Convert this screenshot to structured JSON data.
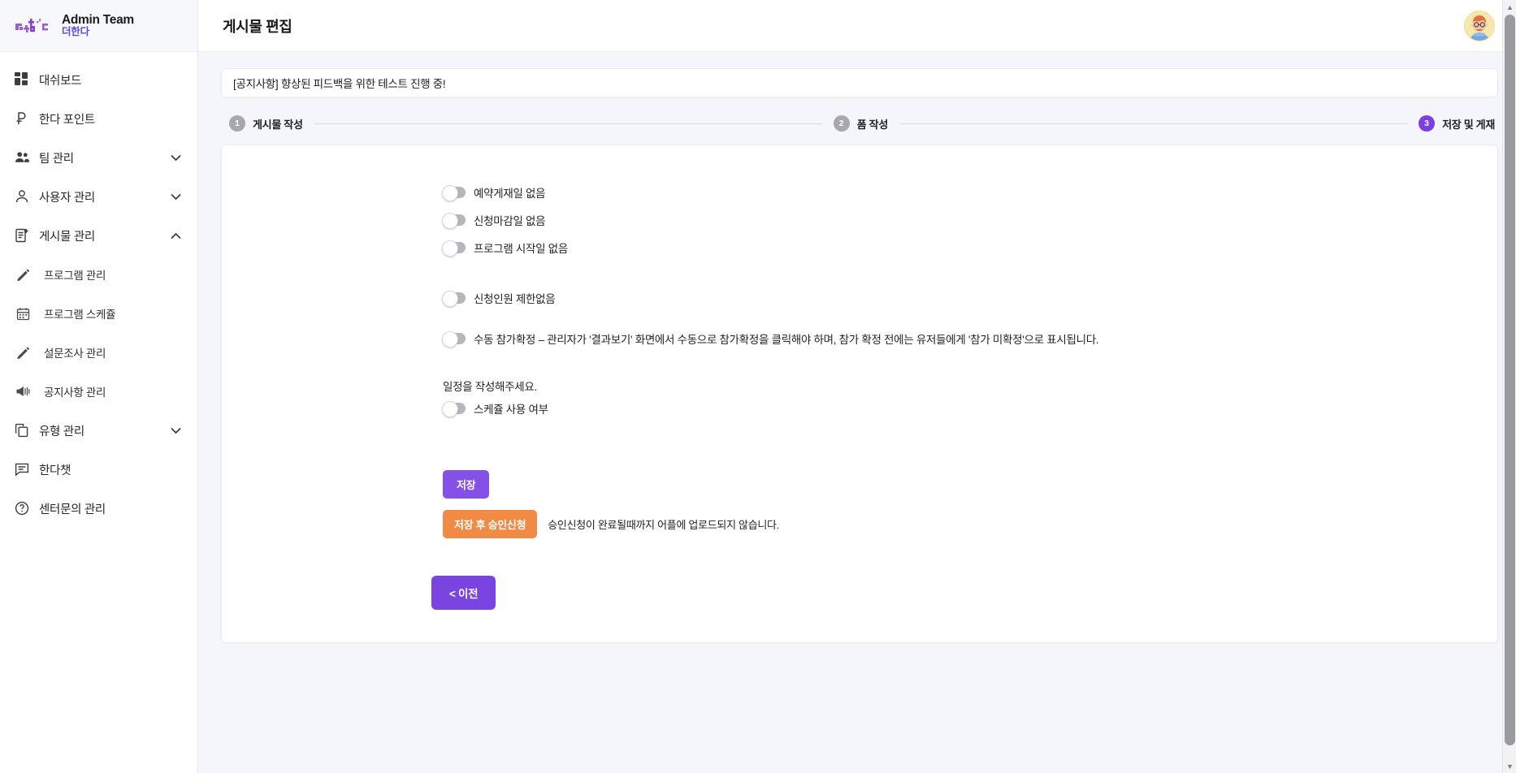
{
  "brand": {
    "title": "Admin Team",
    "subtitle": "더한다",
    "logo_icon": "dahanda-logo-icon"
  },
  "sidebar": {
    "items": [
      {
        "label": "대쉬보드",
        "icon": "dashboard-icon",
        "expandable": false,
        "sub": false
      },
      {
        "label": "한다 포인트",
        "icon": "point-icon",
        "expandable": false,
        "sub": false
      },
      {
        "label": "팀 관리",
        "icon": "group-icon",
        "expandable": true,
        "expanded": false,
        "sub": false
      },
      {
        "label": "사용자 관리",
        "icon": "person-icon",
        "expandable": true,
        "expanded": false,
        "sub": false
      },
      {
        "label": "게시물 관리",
        "icon": "post-add-icon",
        "expandable": true,
        "expanded": true,
        "sub": false
      },
      {
        "label": "프로그램 관리",
        "icon": "pencil-icon",
        "expandable": false,
        "sub": true
      },
      {
        "label": "프로그램 스케쥴",
        "icon": "calendar-icon",
        "expandable": false,
        "sub": true
      },
      {
        "label": "설문조사 관리",
        "icon": "pencil-icon",
        "expandable": false,
        "sub": true
      },
      {
        "label": "공지사항 관리",
        "icon": "megaphone-icon",
        "expandable": false,
        "sub": true
      },
      {
        "label": "유형 관리",
        "icon": "copy-icon",
        "expandable": true,
        "expanded": false,
        "sub": false
      },
      {
        "label": "한다챗",
        "icon": "chat-icon",
        "expandable": false,
        "sub": false
      },
      {
        "label": "센터문의 관리",
        "icon": "help-circle-icon",
        "expandable": false,
        "sub": false
      }
    ]
  },
  "header": {
    "title": "게시물 편집",
    "avatar_icon": "user-avatar"
  },
  "notice": {
    "text": "[공지사항] 향상된 피드백을 위한 테스트 진행 중!"
  },
  "stepper": {
    "steps": [
      {
        "number": "1",
        "label": "게시물 작성",
        "active": false
      },
      {
        "number": "2",
        "label": "폼 작성",
        "active": false
      },
      {
        "number": "3",
        "label": "저장 및 게재",
        "active": true
      }
    ],
    "active_color": "#7b3fe4",
    "inactive_color": "#a7a7ad"
  },
  "form": {
    "toggles_group1": [
      {
        "label": "예약게재일 없음",
        "on": false
      },
      {
        "label": "신청마감일 없음",
        "on": false
      },
      {
        "label": "프로그램 시작일 없음",
        "on": false
      }
    ],
    "toggles_group2": [
      {
        "label": "신청인원 제한없음",
        "on": false
      }
    ],
    "toggles_group3": [
      {
        "label": "수동 참가확정 – 관리자가 '결과보기' 화면에서 수동으로 참가확정을 클릭해야 하며, 참가 확정 전에는 유저들에게 '참가 미확정'으로 표시됩니다.",
        "on": false
      }
    ],
    "schedule_note": "일정을 작성해주세요.",
    "toggles_group4": [
      {
        "label": "스케쥴 사용 여부",
        "on": false
      }
    ]
  },
  "actions": {
    "save_label": "저장",
    "save_color": "#8450e6",
    "approve_label": "저장 후 승인신청",
    "approve_color": "#f08a44",
    "approve_note": "승인신청이 완료될때까지 어플에 업로드되지 않습니다.",
    "prev_label": "< 이전",
    "prev_color": "#7b43e0"
  }
}
